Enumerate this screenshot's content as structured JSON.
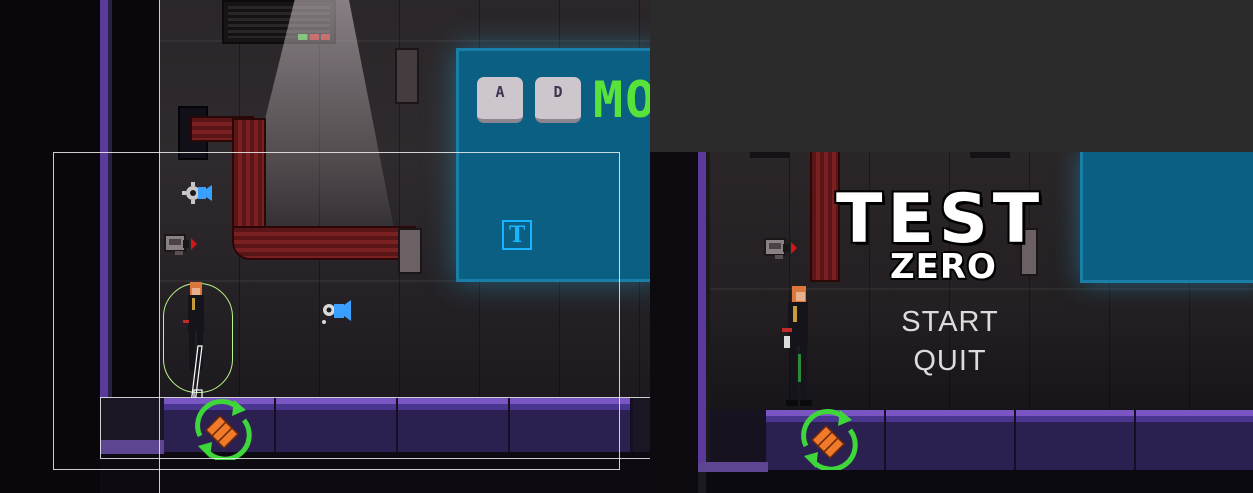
{
  "scene_view": {
    "screen_keys": [
      "A",
      "D"
    ],
    "screen_text": "MO",
    "text_gizmo_glyph": "T",
    "icons": [
      "gear-icon",
      "camera-icon",
      "audio-source-icon",
      "reload-icon",
      "player-sprite"
    ]
  },
  "game_view": {
    "title": "TEST",
    "subtitle": "ZERO",
    "menu": [
      {
        "label": "START"
      },
      {
        "label": "QUIT"
      }
    ],
    "icons": [
      "camera-icon",
      "reload-icon",
      "player-sprite"
    ]
  },
  "colors": {
    "screen_blue": "#0a5f82",
    "screen_text_green": "#58e33a",
    "gizmo_blue": "#18b4ff",
    "collider_green": "#b9f78a",
    "reload_green": "#3ed63a",
    "floor_purple": "#7a56c2",
    "editor_bg": "#2b2b2b"
  }
}
